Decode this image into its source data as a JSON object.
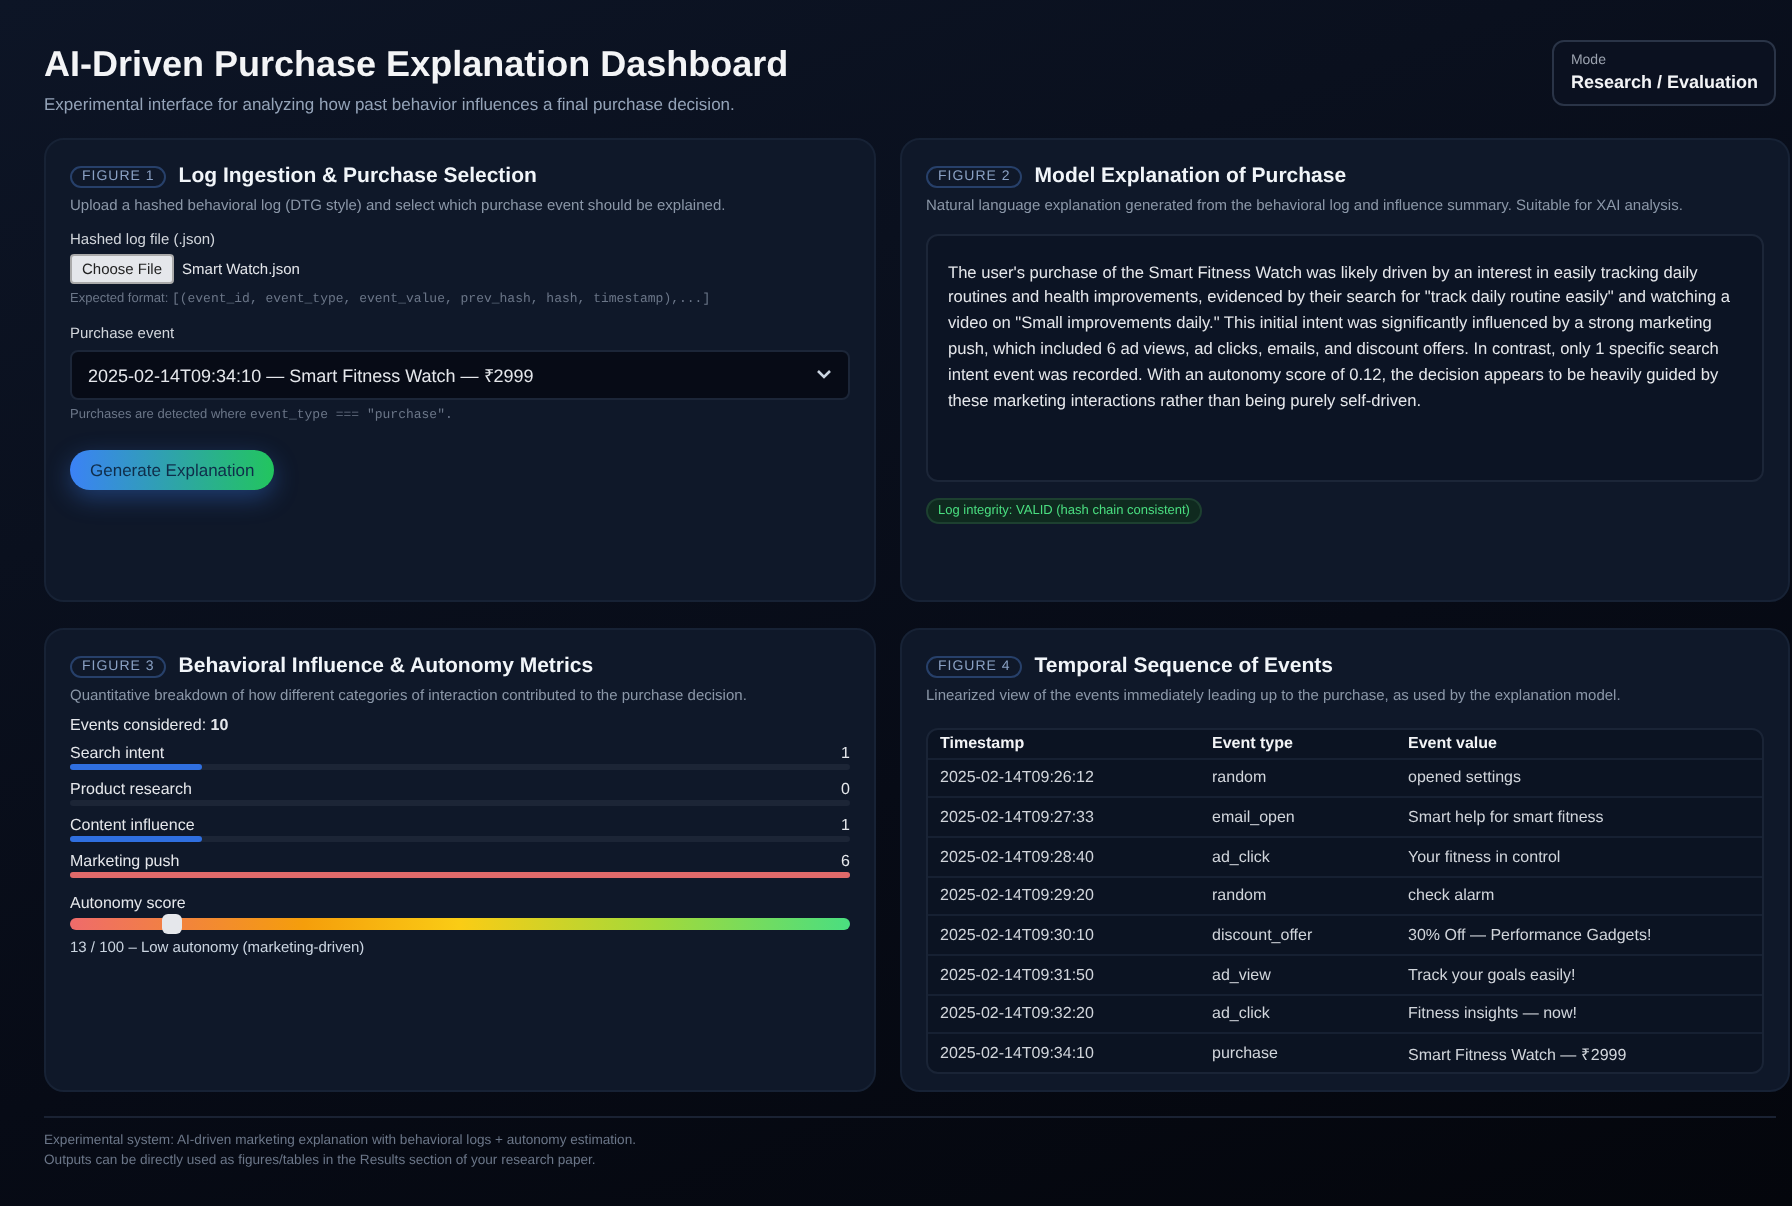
{
  "header": {
    "title": "AI-Driven Purchase Explanation Dashboard",
    "subtitle": "Experimental interface for analyzing how past behavior influences a final purchase decision.",
    "mode": {
      "label": "Mode",
      "value": "Research / Evaluation"
    }
  },
  "figure1": {
    "tag": "FIGURE 1",
    "title": "Log Ingestion & Purchase Selection",
    "description": "Upload a hashed behavioral log (DTG style) and select which purchase event should be explained.",
    "file_label": "Hashed log file (.json)",
    "file_button": "Choose File",
    "file_name": "Smart Watch.json",
    "format_hint": "Expected format: ",
    "format_code": "[(event_id, event_type, event_value, prev_hash, hash, timestamp),...]",
    "event_label": "Purchase event",
    "event_value": "2025-02-14T09:34:10 — Smart Fitness Watch — ₹2999",
    "event_hint": "Purchases are detected where ",
    "event_hint_code": "event_type === \"purchase\".",
    "button": "Generate Explanation"
  },
  "figure2": {
    "tag": "FIGURE 2",
    "title": "Model Explanation of Purchase",
    "description": "Natural language explanation generated from the behavioral log and influence summary. Suitable for XAI analysis.",
    "explanation": "The user's purchase of the Smart Fitness Watch was likely driven by an interest in easily tracking daily routines and health improvements, evidenced by their search for \"track daily routine easily\" and watching a video on \"Small improvements daily.\" This initial intent was significantly influenced by a strong marketing push, which included 6 ad views, ad clicks, emails, and discount offers. In contrast, only 1 specific search intent event was recorded. With an autonomy score of 0.12, the decision appears to be heavily guided by these marketing interactions rather than being purely self-driven.",
    "integrity": "Log integrity: VALID (hash chain consistent)"
  },
  "figure3": {
    "tag": "FIGURE 3",
    "title": "Behavioral Influence & Autonomy Metrics",
    "description": "Quantitative breakdown of how different categories of interaction contributed to the purchase decision.",
    "events_label": "Events considered:",
    "events_count": "10",
    "metrics": [
      {
        "name": "Search intent",
        "count": "1",
        "level": 0.17,
        "color": "#2f6fe0"
      },
      {
        "name": "Product research",
        "count": "0"
      },
      {
        "name": "Content influence",
        "count": "1",
        "level": 0.17,
        "color": "#2f6fe0"
      },
      {
        "name": "Marketing push",
        "count": "6",
        "level": 1,
        "color": "#e06a6a"
      }
    ],
    "autonomy": {
      "label": "Autonomy score",
      "level": 0.13,
      "reading": "13 / 100 – Low autonomy (marketing-driven)"
    }
  },
  "figure4": {
    "tag": "FIGURE 4",
    "title": "Temporal Sequence of Events",
    "description": "Linearized view of the events immediately leading up to the purchase, as used by the explanation model.",
    "columns": [
      "Timestamp",
      "Event type",
      "Event value"
    ],
    "rows": [
      [
        "2025-02-14T09:26:12",
        "random",
        "opened settings"
      ],
      [
        "2025-02-14T09:27:33",
        "email_open",
        "Smart help for smart fitness"
      ],
      [
        "2025-02-14T09:28:40",
        "ad_click",
        "Your fitness in control"
      ],
      [
        "2025-02-14T09:29:20",
        "random",
        "check alarm"
      ],
      [
        "2025-02-14T09:30:10",
        "discount_offer",
        "30% Off — Performance Gadgets!"
      ],
      [
        "2025-02-14T09:31:50",
        "ad_view",
        "Track your goals easily!"
      ],
      [
        "2025-02-14T09:32:20",
        "ad_click",
        "Fitness insights — now!"
      ],
      [
        "2025-02-14T09:34:10",
        "purchase",
        "Smart Fitness Watch — ₹2999"
      ]
    ]
  },
  "footer": [
    "Experimental system: AI-driven marketing explanation with behavioral logs + autonomy estimation.",
    "Outputs can be directly used as figures/tables in the Results section of your research paper."
  ]
}
